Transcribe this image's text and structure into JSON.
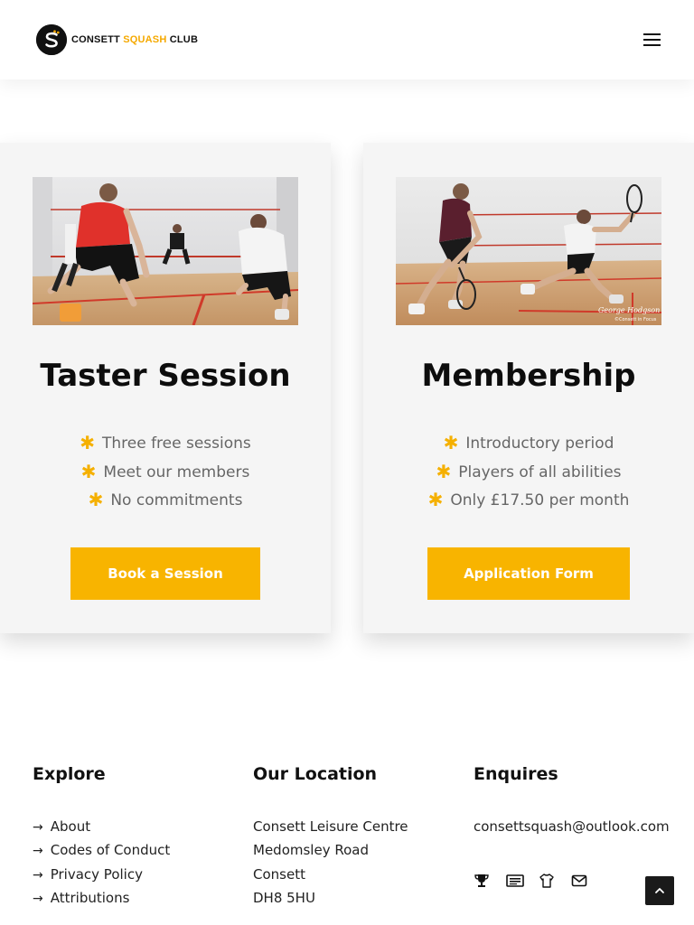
{
  "header": {
    "logo_text_1": "CONSETT ",
    "logo_text_accent": "SQUASH",
    "logo_text_2": " CLUB",
    "accent_color": "#f5a900"
  },
  "cards": [
    {
      "title": "Taster Session",
      "features": [
        "Three free sessions",
        "Meet our members",
        "No commitments"
      ],
      "button": "Book a Session",
      "image_icon": "squash-players-photo"
    },
    {
      "title": "Membership",
      "features": [
        "Introductory period",
        "Players of all abilities",
        "Only £17.50 per month"
      ],
      "button": "Application Form",
      "image_icon": "squash-match-photo",
      "image_caption": "George Hodgson",
      "image_credit": "©Consett in Focus"
    }
  ],
  "feature_bullet": "✱",
  "button_color": "#f8b400",
  "footer": {
    "explore": {
      "heading": "Explore",
      "links": [
        "About",
        "Codes of Conduct",
        "Privacy Policy",
        "Attributions"
      ]
    },
    "location": {
      "heading": "Our Location",
      "lines": [
        "Consett Leisure Centre",
        "Medomsley Road",
        "Consett",
        "DH8 5HU"
      ]
    },
    "enquires": {
      "heading": "Enquires",
      "email": "consettsquash@outlook.com",
      "social_icons": [
        "trophy-icon",
        "newspaper-icon",
        "shirt-icon",
        "mail-icon"
      ]
    }
  }
}
